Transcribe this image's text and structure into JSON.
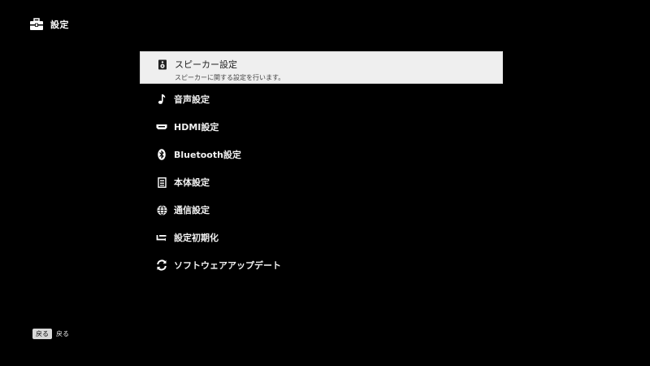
{
  "header": {
    "icon": "toolbox-icon",
    "title": "設定"
  },
  "menu": {
    "items": [
      {
        "label": "スピーカー設定",
        "description": "スピーカーに関する設定を行います。",
        "icon": "speaker-icon",
        "selected": true
      },
      {
        "label": "音声設定",
        "icon": "music-note-icon"
      },
      {
        "label": "HDMI設定",
        "icon": "hdmi-icon"
      },
      {
        "label": "Bluetooth設定",
        "icon": "bluetooth-icon"
      },
      {
        "label": "本体設定",
        "icon": "device-icon"
      },
      {
        "label": "通信設定",
        "icon": "globe-icon"
      },
      {
        "label": "設定初期化",
        "icon": "reset-icon"
      },
      {
        "label": "ソフトウェアアップデート",
        "icon": "refresh-icon"
      }
    ]
  },
  "footer": {
    "key": "戻る",
    "label": "戻る"
  },
  "colors": {
    "background": "#000000",
    "selected_background": "#efefef",
    "text": "#f2f2f2"
  }
}
